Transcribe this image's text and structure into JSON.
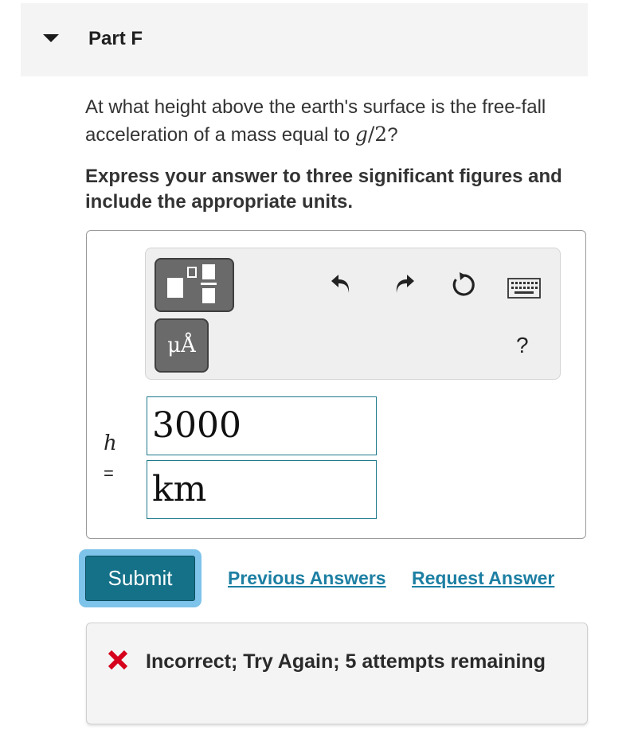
{
  "part": {
    "title": "Part F",
    "toggle_icon": "caret-down-icon"
  },
  "question": {
    "text_before": "At what height above the earth's surface is the free-fall acceleration of a mass equal to ",
    "math_var": "g",
    "math_rest": "/2",
    "text_after": "?"
  },
  "instructions": "Express your answer to three significant figures and include the appropriate units.",
  "toolbar": {
    "templates_icon": "templates-icon",
    "units_label": "μÅ",
    "undo_icon": "undo-icon",
    "redo_icon": "redo-icon",
    "reset_icon": "reset-icon",
    "keyboard_icon": "keyboard-icon",
    "help_label": "?"
  },
  "answer": {
    "variable": "h",
    "equals": "=",
    "value": "3000",
    "units": "km"
  },
  "actions": {
    "submit_label": "Submit",
    "previous_answers_label": "Previous Answers",
    "request_answer_label": "Request Answer"
  },
  "feedback": {
    "icon": "x-mark-icon",
    "text": "Incorrect; Try Again; 5 attempts remaining",
    "icon_color": "#d6001c"
  },
  "colors": {
    "accent": "#147188",
    "link": "#1d7fa3",
    "focus_ring": "#7ec3ea"
  }
}
